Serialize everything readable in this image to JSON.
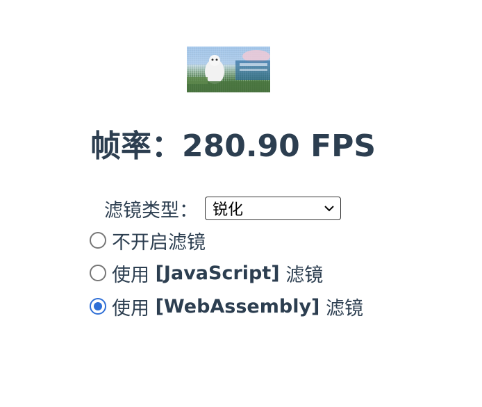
{
  "fps": {
    "label": "帧率：",
    "value": "280.90 FPS"
  },
  "filter": {
    "label": "滤镜类型：",
    "selected": "锐化"
  },
  "radios": [
    {
      "prefix": "不开启滤镜",
      "tech": "",
      "suffix": "",
      "checked": false
    },
    {
      "prefix": "使用 ",
      "tech": "[JavaScript]",
      "suffix": " 滤镜",
      "checked": false
    },
    {
      "prefix": "使用 ",
      "tech": "[WebAssembly]",
      "suffix": " 滤镜",
      "checked": true
    }
  ],
  "colors": {
    "text": "#2c3e50",
    "radio_checked": "#2f6fd6"
  }
}
